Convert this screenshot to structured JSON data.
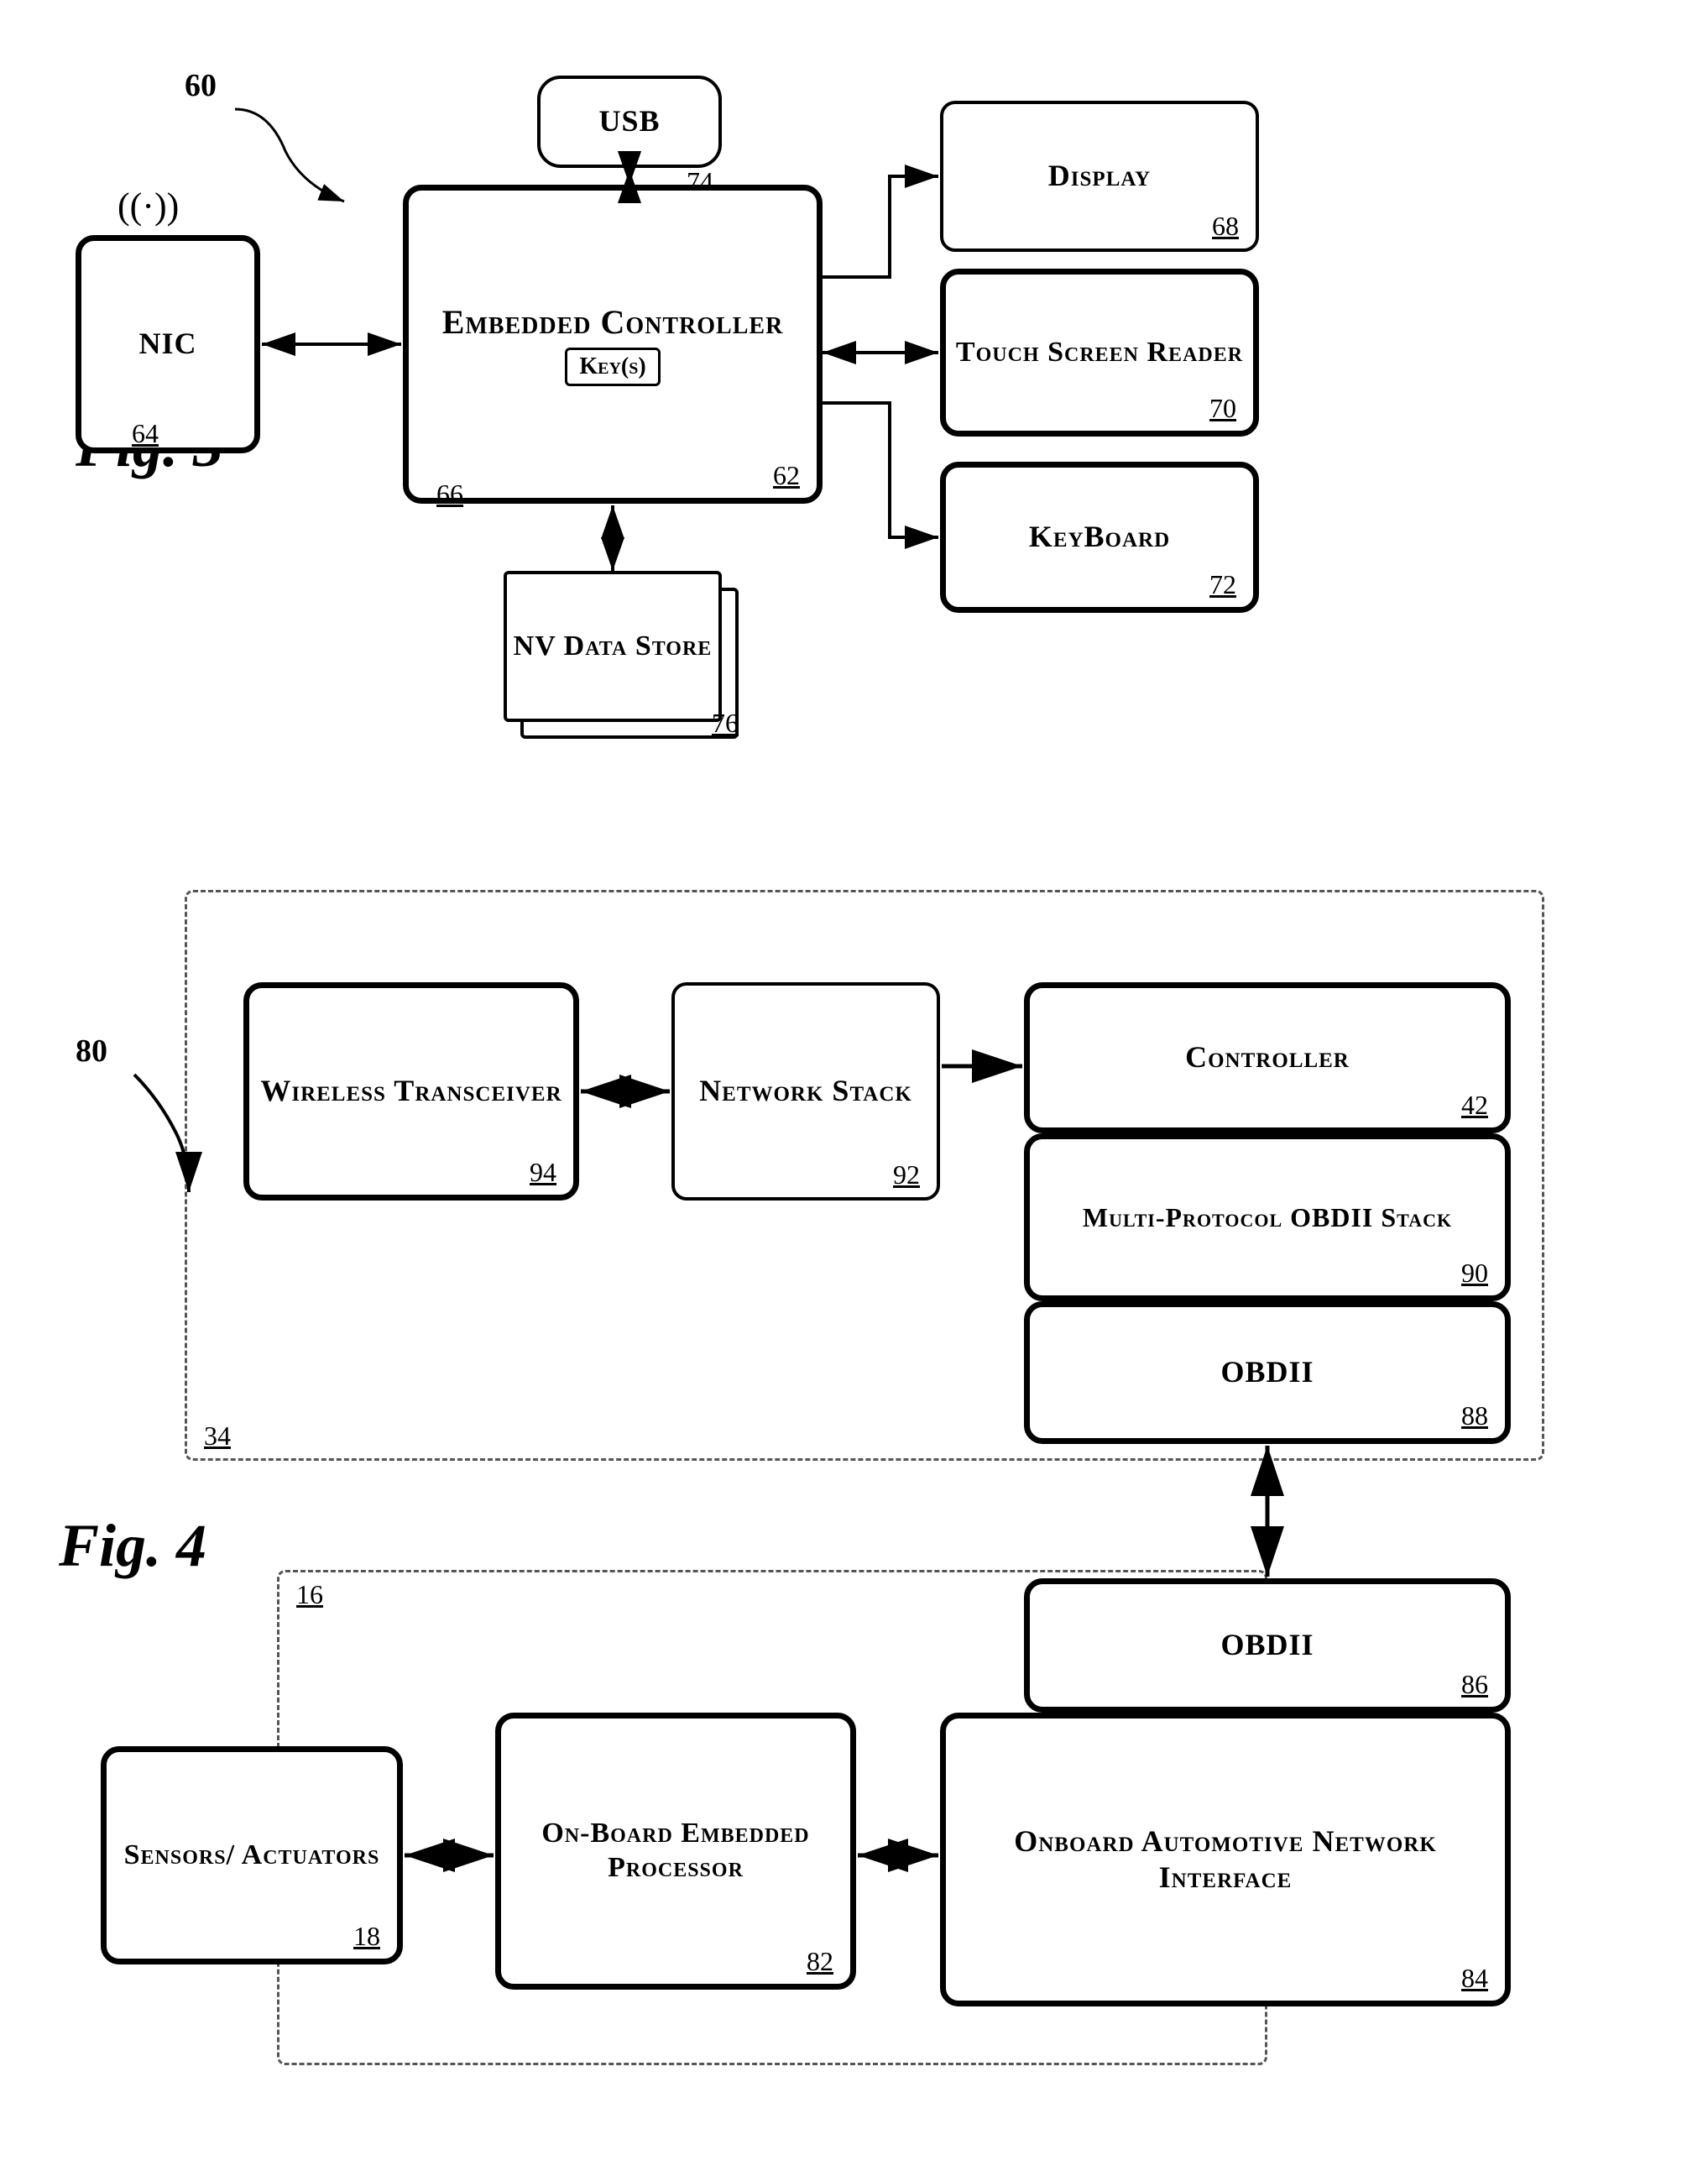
{
  "fig3": {
    "label": "Fig. 3",
    "ref_60": "60",
    "usb": {
      "label": "USB",
      "ref": "74"
    },
    "embedded_controller": {
      "label": "Embedded Controller",
      "ref": "62",
      "keys": "Key(s)",
      "keys_ref": "66"
    },
    "nic": {
      "label": "NIC",
      "ref": "64"
    },
    "display": {
      "label": "Display",
      "ref": "68"
    },
    "touch_screen": {
      "label": "Touch Screen Reader",
      "ref": "70"
    },
    "keyboard": {
      "label": "KeyBoard",
      "ref": "72"
    },
    "nv_data": {
      "label": "NV Data Store",
      "ref": "76"
    }
  },
  "fig4": {
    "label": "Fig. 4",
    "ref_80": "80",
    "dashed_box_34": "34",
    "dashed_box_16": "16",
    "wireless_transceiver": {
      "label": "Wireless Transceiver",
      "ref": "94"
    },
    "network_stack": {
      "label": "Network Stack",
      "ref": "92"
    },
    "controller": {
      "label": "Controller",
      "ref": "42"
    },
    "multi_protocol": {
      "label": "Multi-Protocol OBDII Stack",
      "ref": "90"
    },
    "obdii_top": {
      "label": "OBDII",
      "ref": "88"
    },
    "obdii_bottom": {
      "label": "OBDII",
      "ref": "86"
    },
    "onboard_automotive": {
      "label": "Onboard Automotive Network Interface",
      "ref": "84"
    },
    "on_board_embedded": {
      "label": "On-Board Embedded Processor",
      "ref": "82"
    },
    "sensors_actuators": {
      "label": "Sensors/ Actuators",
      "ref": "18"
    }
  },
  "icons": {
    "wireless": "((·))"
  }
}
